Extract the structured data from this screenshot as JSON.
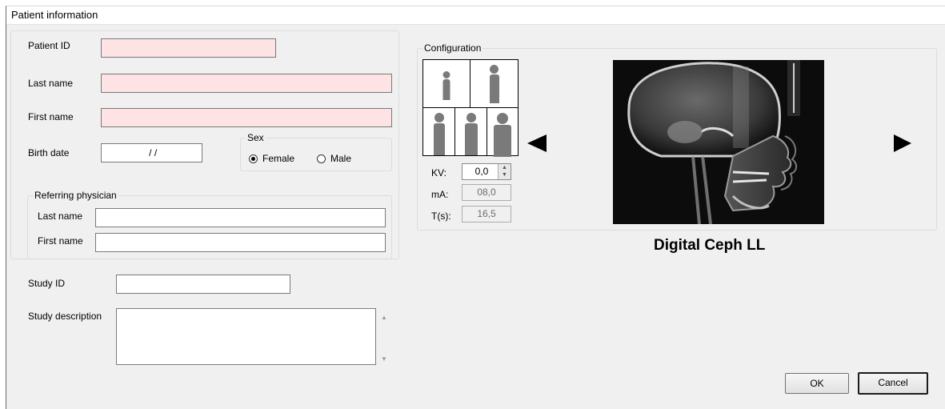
{
  "window": {
    "title": "Patient information"
  },
  "patient": {
    "patient_id_label": "Patient ID",
    "patient_id_value": "",
    "last_name_label": "Last name",
    "last_name_value": "",
    "first_name_label": "First name",
    "first_name_value": "",
    "birth_date_label": "Birth date",
    "birth_date_value": " / /"
  },
  "sex": {
    "title": "Sex",
    "options": [
      {
        "label": "Female",
        "selected": true
      },
      {
        "label": "Male",
        "selected": false
      }
    ]
  },
  "referring_physician": {
    "title": "Referring physician",
    "last_name_label": "Last name",
    "last_name_value": "",
    "first_name_label": "First name",
    "first_name_value": ""
  },
  "study": {
    "study_id_label": "Study ID",
    "study_id_value": "",
    "description_label": "Study description",
    "description_value": ""
  },
  "configuration": {
    "title": "Configuration",
    "kv_label": "KV:",
    "kv_value": "0,0",
    "ma_label": "mA:",
    "ma_value": "08,0",
    "ts_label": "T(s):",
    "ts_value": "16,5",
    "exam_name": "Digital Ceph LL",
    "prev_icon": "triangle-left-icon",
    "next_icon": "triangle-right-icon"
  },
  "buttons": {
    "ok": "OK",
    "cancel": "Cancel"
  },
  "colors": {
    "required_field": "#fde3e3",
    "dialog_bg": "#f0f0f0"
  }
}
